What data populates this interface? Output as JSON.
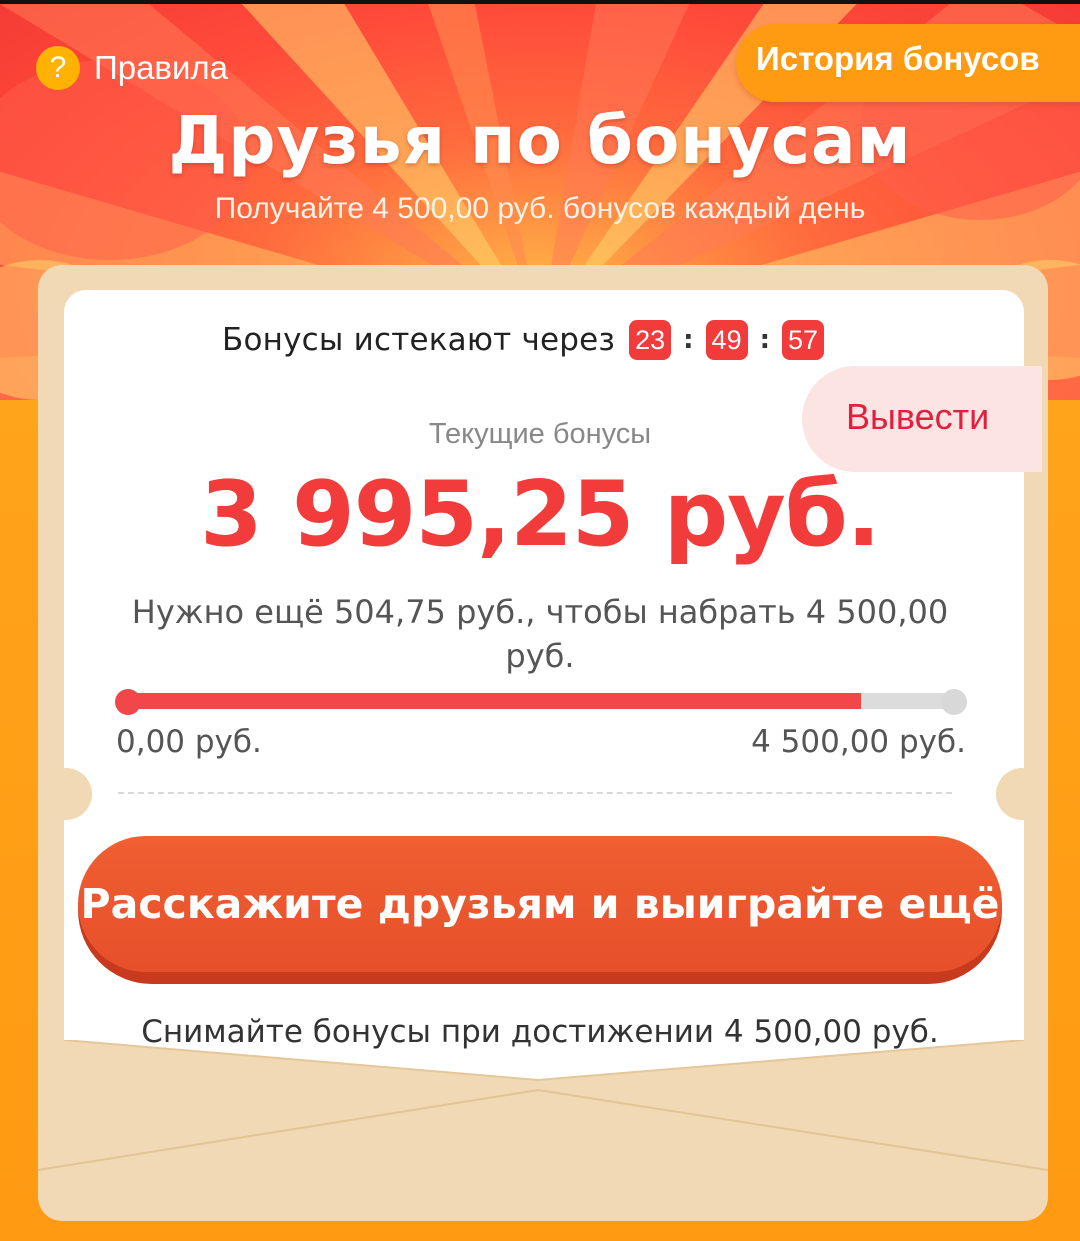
{
  "header": {
    "rules_icon": "?",
    "rules_label": "Правила",
    "history_label": "История бонусов"
  },
  "hero": {
    "title": "Друзья по бонусам",
    "subtitle": "Получайте 4 500,00 руб. бонусов каждый день"
  },
  "card": {
    "expire_label": "Бонусы истекают через",
    "timer": {
      "hours": "23",
      "minutes": "49",
      "seconds": "57",
      "separator": ":"
    },
    "withdraw_label": "Вывести",
    "current_label": "Текущие бонусы",
    "current_amount": "3 995,25 руб.",
    "need_text": "Нужно ещё 504,75 руб., чтобы набрать 4 500,00 руб.",
    "progress": {
      "min_label": "0,00 руб.",
      "max_label": "4 500,00 руб.",
      "value": 3995.25,
      "max": 4500
    },
    "share_button": "Расскажите друзьям и выиграйте ещё",
    "footer_note": "Снимайте бонусы при достижении 4 500,00 руб."
  },
  "colors": {
    "accent_red": "#f23b3b",
    "button_orange": "#ee5a2f",
    "history_orange": "#ff9b12",
    "envelope": "#f0d9b4"
  },
  "icons": {
    "rules": "question-icon"
  }
}
